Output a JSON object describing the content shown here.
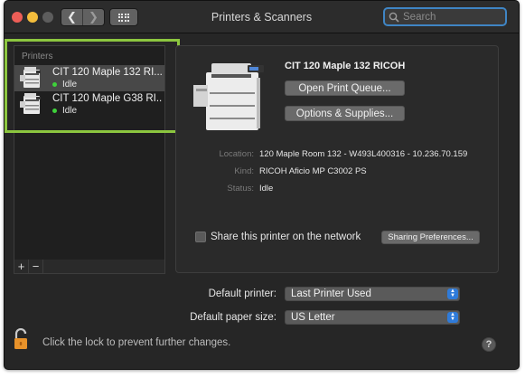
{
  "window": {
    "title": "Printers & Scanners",
    "search_placeholder": "Search"
  },
  "printers": {
    "header": "Printers",
    "items": [
      {
        "name": "CIT 120 Maple 132 RI...",
        "status": "Idle",
        "selected": true
      },
      {
        "name": "CIT 120 Maple G38 RI...",
        "status": "Idle",
        "selected": false
      }
    ],
    "add_label": "+",
    "remove_label": "−"
  },
  "detail": {
    "name": "CIT 120 Maple 132 RICOH",
    "open_queue_label": "Open Print Queue...",
    "options_label": "Options & Supplies...",
    "location_label": "Location:",
    "location_value": "120 Maple Room 132 - W493L400316 - 10.236.70.159",
    "kind_label": "Kind:",
    "kind_value": "RICOH Aficio MP C3002 PS",
    "status_label": "Status:",
    "status_value": "Idle",
    "share_label": "Share this printer on the network",
    "share_checked": false,
    "sharing_prefs_label": "Sharing Preferences..."
  },
  "defaults": {
    "printer_label": "Default printer:",
    "printer_value": "Last Printer Used",
    "paper_label": "Default paper size:",
    "paper_value": "US Letter"
  },
  "footer": {
    "lock_text": "Click the lock to prevent further changes.",
    "help_label": "?"
  },
  "colors": {
    "highlight": "#8cc63f",
    "status_dot": "#3ed13a",
    "accent": "#2f7bd9",
    "search_focus": "#3f85c4"
  }
}
